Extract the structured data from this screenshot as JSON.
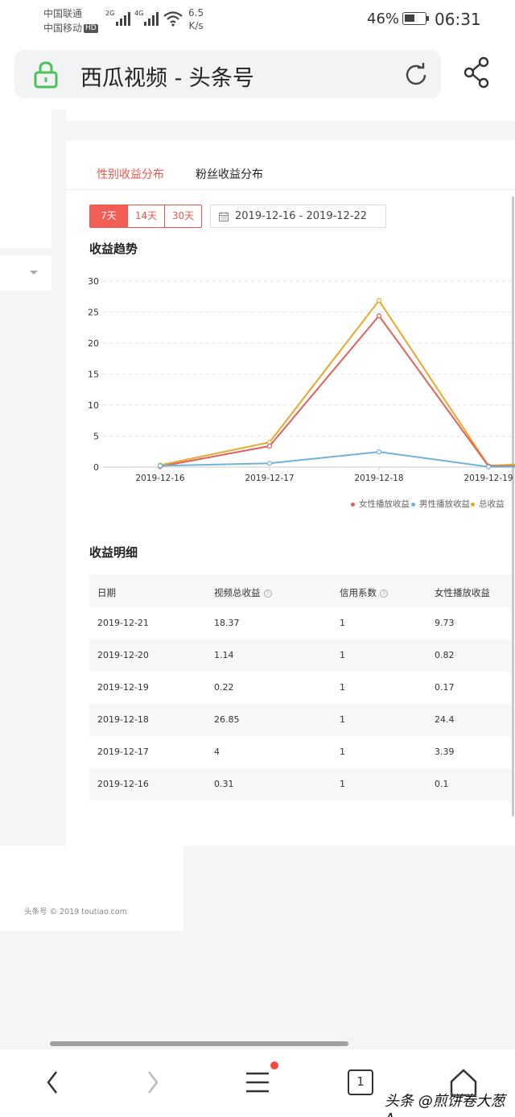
{
  "status_bar": {
    "carrier1": "中国联通",
    "carrier2": "中国移动",
    "hd": "HD",
    "net1": "2G",
    "net2": "4G",
    "speed_value": "6.5",
    "speed_unit": "K/s",
    "battery": "46%",
    "time": "06:31"
  },
  "browser": {
    "title": "西瓜视频 - 头条号",
    "icons": [
      "lock-icon",
      "reload-icon",
      "share-icon"
    ],
    "tab_count": "1"
  },
  "tabs": [
    {
      "label": "性别收益分布",
      "active": true
    },
    {
      "label": "粉丝收益分布",
      "active": false
    }
  ],
  "range_buttons": [
    "7天",
    "14天",
    "30天"
  ],
  "date_range": "2019-12-16 - 2019-12-22",
  "trend_title": "收益趋势",
  "detail_title": "收益明细",
  "chart_data": {
    "type": "line",
    "title": "收益趋势",
    "x": [
      "2019-12-16",
      "2019-12-17",
      "2019-12-18",
      "2019-12-19"
    ],
    "ylim": [
      0,
      30
    ],
    "yticks": [
      0,
      5,
      10,
      15,
      20,
      25,
      30
    ],
    "grid": true,
    "legend_position": "bottom-right",
    "series": [
      {
        "name": "女性播放收益",
        "color": "#e0625b",
        "values": [
          0.1,
          3.39,
          24.4,
          0.17
        ]
      },
      {
        "name": "男性播放收益",
        "color": "#6fb3d9",
        "values": [
          0.21,
          0.61,
          2.45,
          0.05
        ]
      },
      {
        "name": "总收益",
        "color": "#eaa72a",
        "values": [
          0.31,
          4,
          26.85,
          0.22
        ]
      }
    ]
  },
  "table": {
    "headers": [
      "日期",
      "视频总收益",
      "信用系数",
      "女性播放收益"
    ],
    "help_icon": "?",
    "rows": [
      [
        "2019-12-21",
        "18.37",
        "1",
        "9.73"
      ],
      [
        "2019-12-20",
        "1.14",
        "1",
        "0.82"
      ],
      [
        "2019-12-19",
        "0.22",
        "1",
        "0.17"
      ],
      [
        "2019-12-18",
        "26.85",
        "1",
        "24.4"
      ],
      [
        "2019-12-17",
        "4",
        "1",
        "3.39"
      ],
      [
        "2019-12-16",
        "0.31",
        "1",
        "0.1"
      ]
    ]
  },
  "footer": "头条号 © 2019 toutiao.com",
  "watermark": "头条 @煎饼卷大葱A",
  "colors": {
    "accent": "#e8584d",
    "female": "#e0625b",
    "male": "#6fb3d9",
    "total": "#eaa72a"
  }
}
